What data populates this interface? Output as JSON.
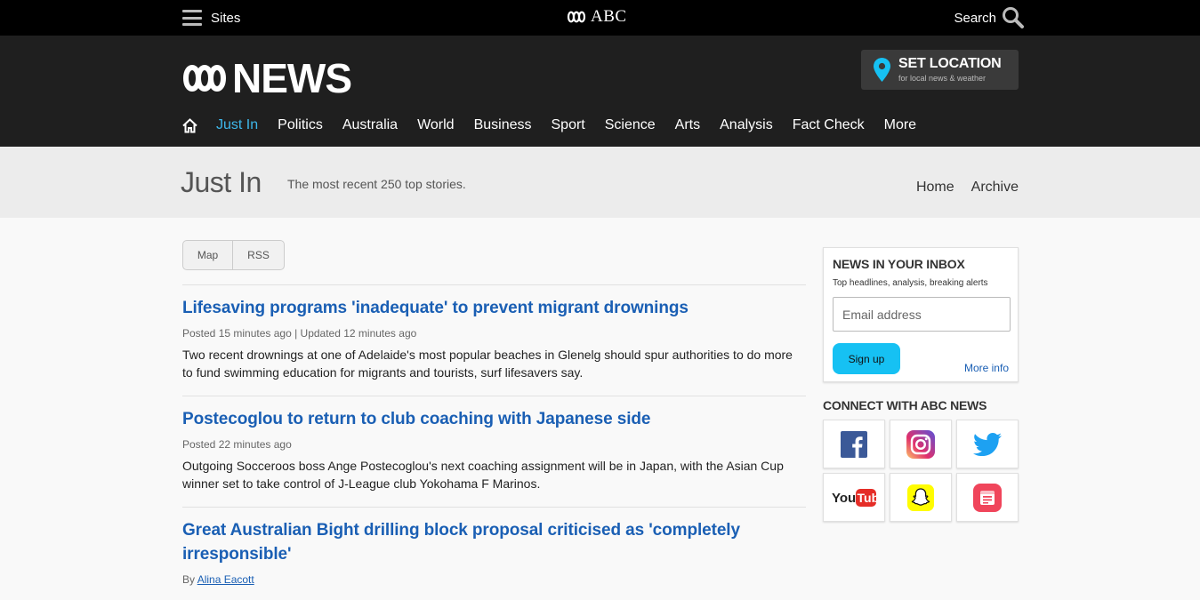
{
  "topbar": {
    "sites_label": "Sites",
    "abc_label": "ABC",
    "search_label": "Search"
  },
  "header": {
    "logo_text": "NEWS",
    "set_location": {
      "title": "SET LOCATION",
      "subtitle": "for local news & weather"
    },
    "nav": [
      {
        "label": "Just In",
        "active": true
      },
      {
        "label": "Politics"
      },
      {
        "label": "Australia"
      },
      {
        "label": "World"
      },
      {
        "label": "Business"
      },
      {
        "label": "Sport"
      },
      {
        "label": "Science"
      },
      {
        "label": "Arts"
      },
      {
        "label": "Analysis"
      },
      {
        "label": "Fact Check"
      },
      {
        "label": "More"
      }
    ]
  },
  "subheader": {
    "title": "Just In",
    "description": "The most recent 250 top stories.",
    "links": [
      "Home",
      "Archive"
    ]
  },
  "buttons": {
    "map": "Map",
    "rss": "RSS"
  },
  "articles": [
    {
      "title": "Lifesaving programs 'inadequate' to prevent migrant drownings",
      "meta": "Posted 15 minutes ago | Updated 12 minutes ago",
      "summary": "Two recent drownings at one of Adelaide's most popular beaches in Glenelg should spur authorities to do more to fund swimming education for migrants and tourists, surf lifesavers say."
    },
    {
      "title": "Postecoglou to return to club coaching with Japanese side",
      "meta": "Posted 22 minutes ago",
      "summary": "Outgoing Socceroos boss Ange Postecoglou's next coaching assignment will be in Japan, with the Asian Cup winner set to take control of J-League club Yokohama F Marinos."
    },
    {
      "title": "Great Australian Bight drilling block proposal criticised as 'completely irresponsible'",
      "meta_prefix": "By",
      "author": "Alina Eacott"
    }
  ],
  "inbox": {
    "title": "NEWS IN YOUR INBOX",
    "subtitle": "Top headlines, analysis, breaking alerts",
    "email_placeholder": "Email address",
    "signup_label": "Sign up",
    "more_info_label": "More info"
  },
  "connect": {
    "title": "CONNECT WITH ABC NEWS",
    "icons": [
      "facebook-icon",
      "instagram-icon",
      "twitter-icon",
      "youtube-icon",
      "snapchat-icon",
      "apple-news-icon"
    ]
  },
  "colors": {
    "accent_blue": "#1a5fb4",
    "nav_active": "#3eb7ea",
    "signup_button": "#16c1f3",
    "location_pin": "#16c1f3"
  }
}
